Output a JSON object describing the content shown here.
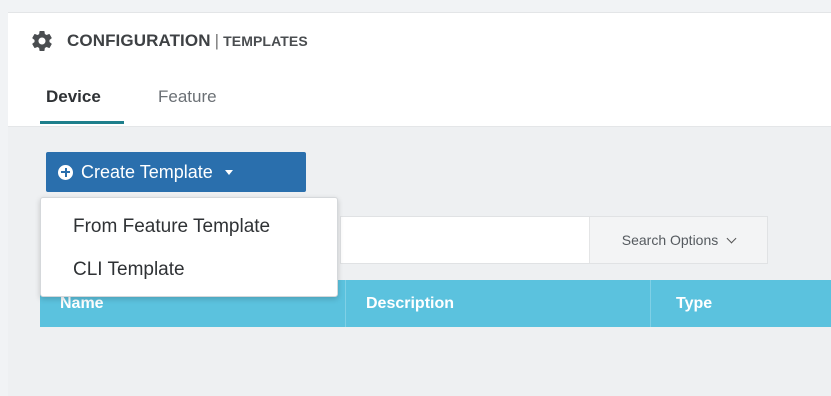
{
  "header": {
    "title": "CONFIGURATION",
    "separator": "|",
    "subtitle": "TEMPLATES",
    "icon": "gear-icon"
  },
  "tabs": [
    {
      "label": "Device",
      "active": true
    },
    {
      "label": "Feature",
      "active": false
    }
  ],
  "toolbar": {
    "create_label": "Create Template",
    "create_icon": "plus-circle-icon"
  },
  "dropdown": {
    "items": [
      {
        "label": "From Feature Template"
      },
      {
        "label": "CLI Template"
      }
    ]
  },
  "search": {
    "options_label": "Search Options"
  },
  "table": {
    "columns": [
      "Name",
      "Description",
      "Type"
    ]
  },
  "colors": {
    "primary_button": "#2a6fad",
    "table_header": "#5bc2de",
    "active_tab_underline": "#1e7f8c"
  }
}
